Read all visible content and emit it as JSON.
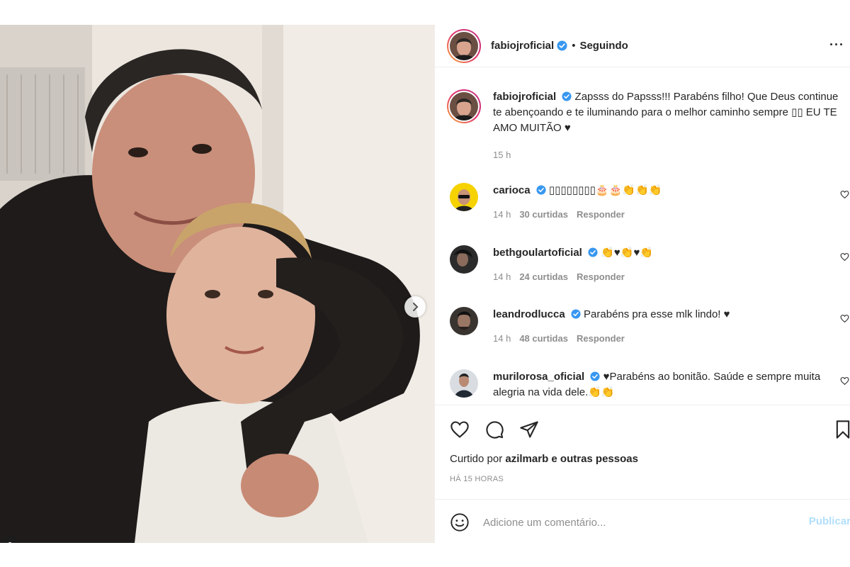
{
  "post": {
    "author": "fabiojroficial",
    "following_label": "Seguindo",
    "separator": "•",
    "more_label": "···"
  },
  "caption": {
    "username": "fabiojroficial",
    "text": "Zapsss do Papsss!!! Parabéns filho! Que Deus continue te abençoando e te iluminando para o melhor caminho sempre ▯▯ EU TE AMO MUITÃO ♥",
    "time": "15 h"
  },
  "comments": [
    {
      "username": "carioca",
      "verified": true,
      "text": "▯▯▯▯▯▯▯▯🎂🎂👏👏👏",
      "time": "14 h",
      "likes": "30 curtidas",
      "reply": "Responder"
    },
    {
      "username": "bethgoulartoficial",
      "verified": true,
      "text": "👏♥👏♥👏",
      "time": "14 h",
      "likes": "24 curtidas",
      "reply": "Responder"
    },
    {
      "username": "leandrodlucca",
      "verified": true,
      "text": "Parabéns pra esse mlk lindo! ♥",
      "time": "14 h",
      "likes": "48 curtidas",
      "reply": "Responder"
    },
    {
      "username": "murilorosa_oficial",
      "verified": true,
      "text": "♥Parabéns ao bonitão. Saúde e sempre muita alegria na vida dele.👏👏",
      "time": "",
      "likes": "",
      "reply": ""
    }
  ],
  "likes": {
    "prefix": "Curtido por",
    "user": "azilmarb",
    "suffix": "e outras pessoas"
  },
  "posted_ago": "HÁ 15 HORAS",
  "add_comment": {
    "placeholder": "Adicione um comentário...",
    "publish_label": "Publicar"
  },
  "carousel": {
    "count": 2,
    "active": 0
  },
  "colors": {
    "verified": "#3897f0",
    "publish": "#b2dffc",
    "meta": "#8e8e8e"
  }
}
